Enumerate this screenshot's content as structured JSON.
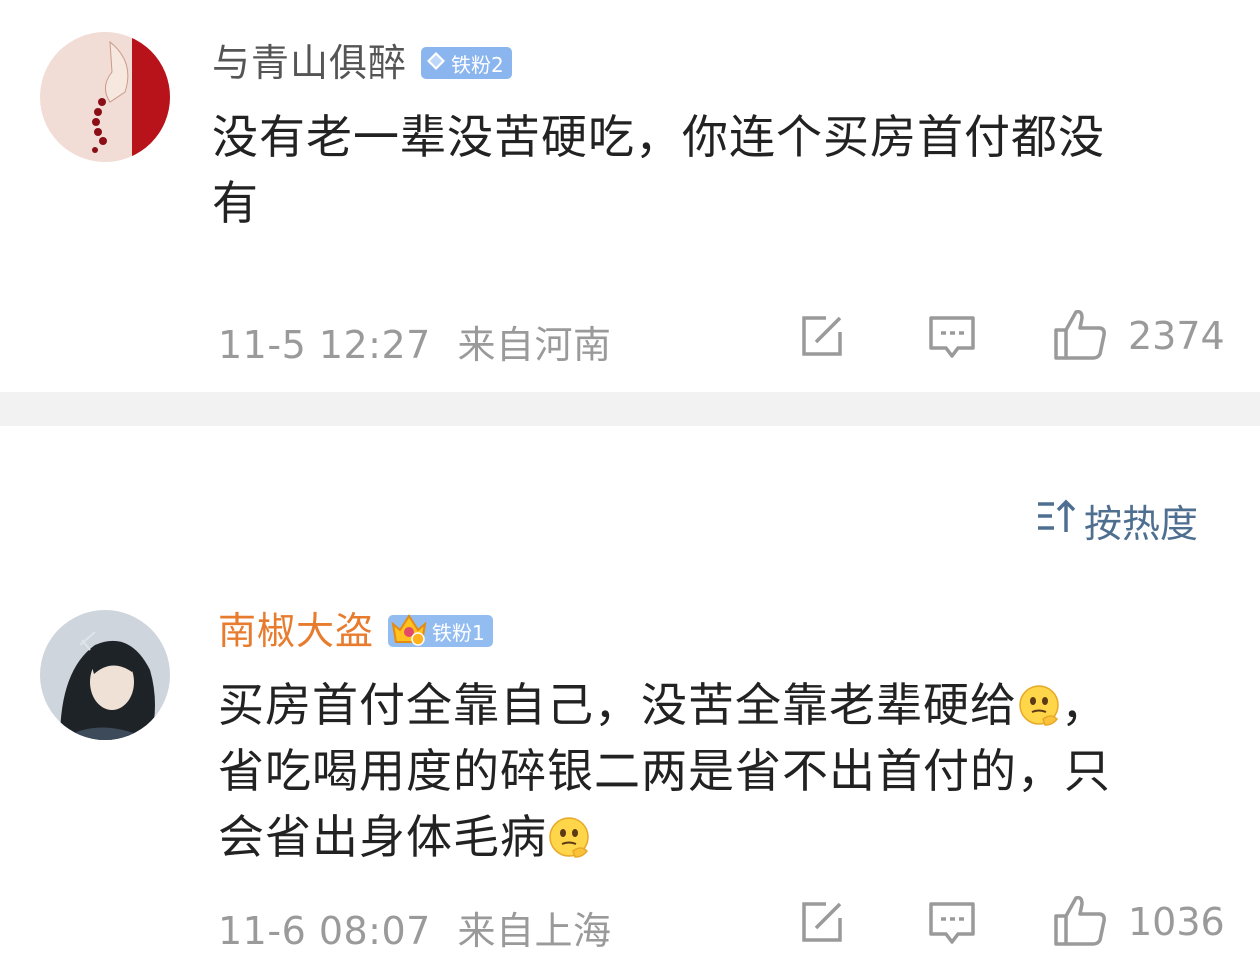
{
  "comments": [
    {
      "username": "与青山俱醉",
      "username_color": "#555555",
      "badge": "铁粉2",
      "content_lines": [
        "没有老一辈没苦硬吃，你连个买房首付都没",
        "有"
      ],
      "time": "11-5 12:27",
      "location": "来自河南",
      "likes": "2374"
    },
    {
      "username": "南椒大盗",
      "username_color": "#e87c2e",
      "badge": "铁粉1",
      "content_lines": [
        "买房首付全靠自己，没苦全靠老辈硬给",
        "省吃喝用度的碎银二两是省不出首付的，只",
        "会省出身体毛病"
      ],
      "content_suffix": "，",
      "time": "11-6 08:07",
      "location": "来自上海",
      "likes": "1036"
    }
  ],
  "sort": {
    "label": "按热度",
    "icon": "sort-icon"
  },
  "icons": [
    "share-icon",
    "comment-icon",
    "like-icon",
    "thinking-emoji"
  ],
  "colors": {
    "meta": "#9a9a9a",
    "divider": "#f2f2f2",
    "sort": "#4f6f90",
    "badge": "#8ab5ee"
  }
}
